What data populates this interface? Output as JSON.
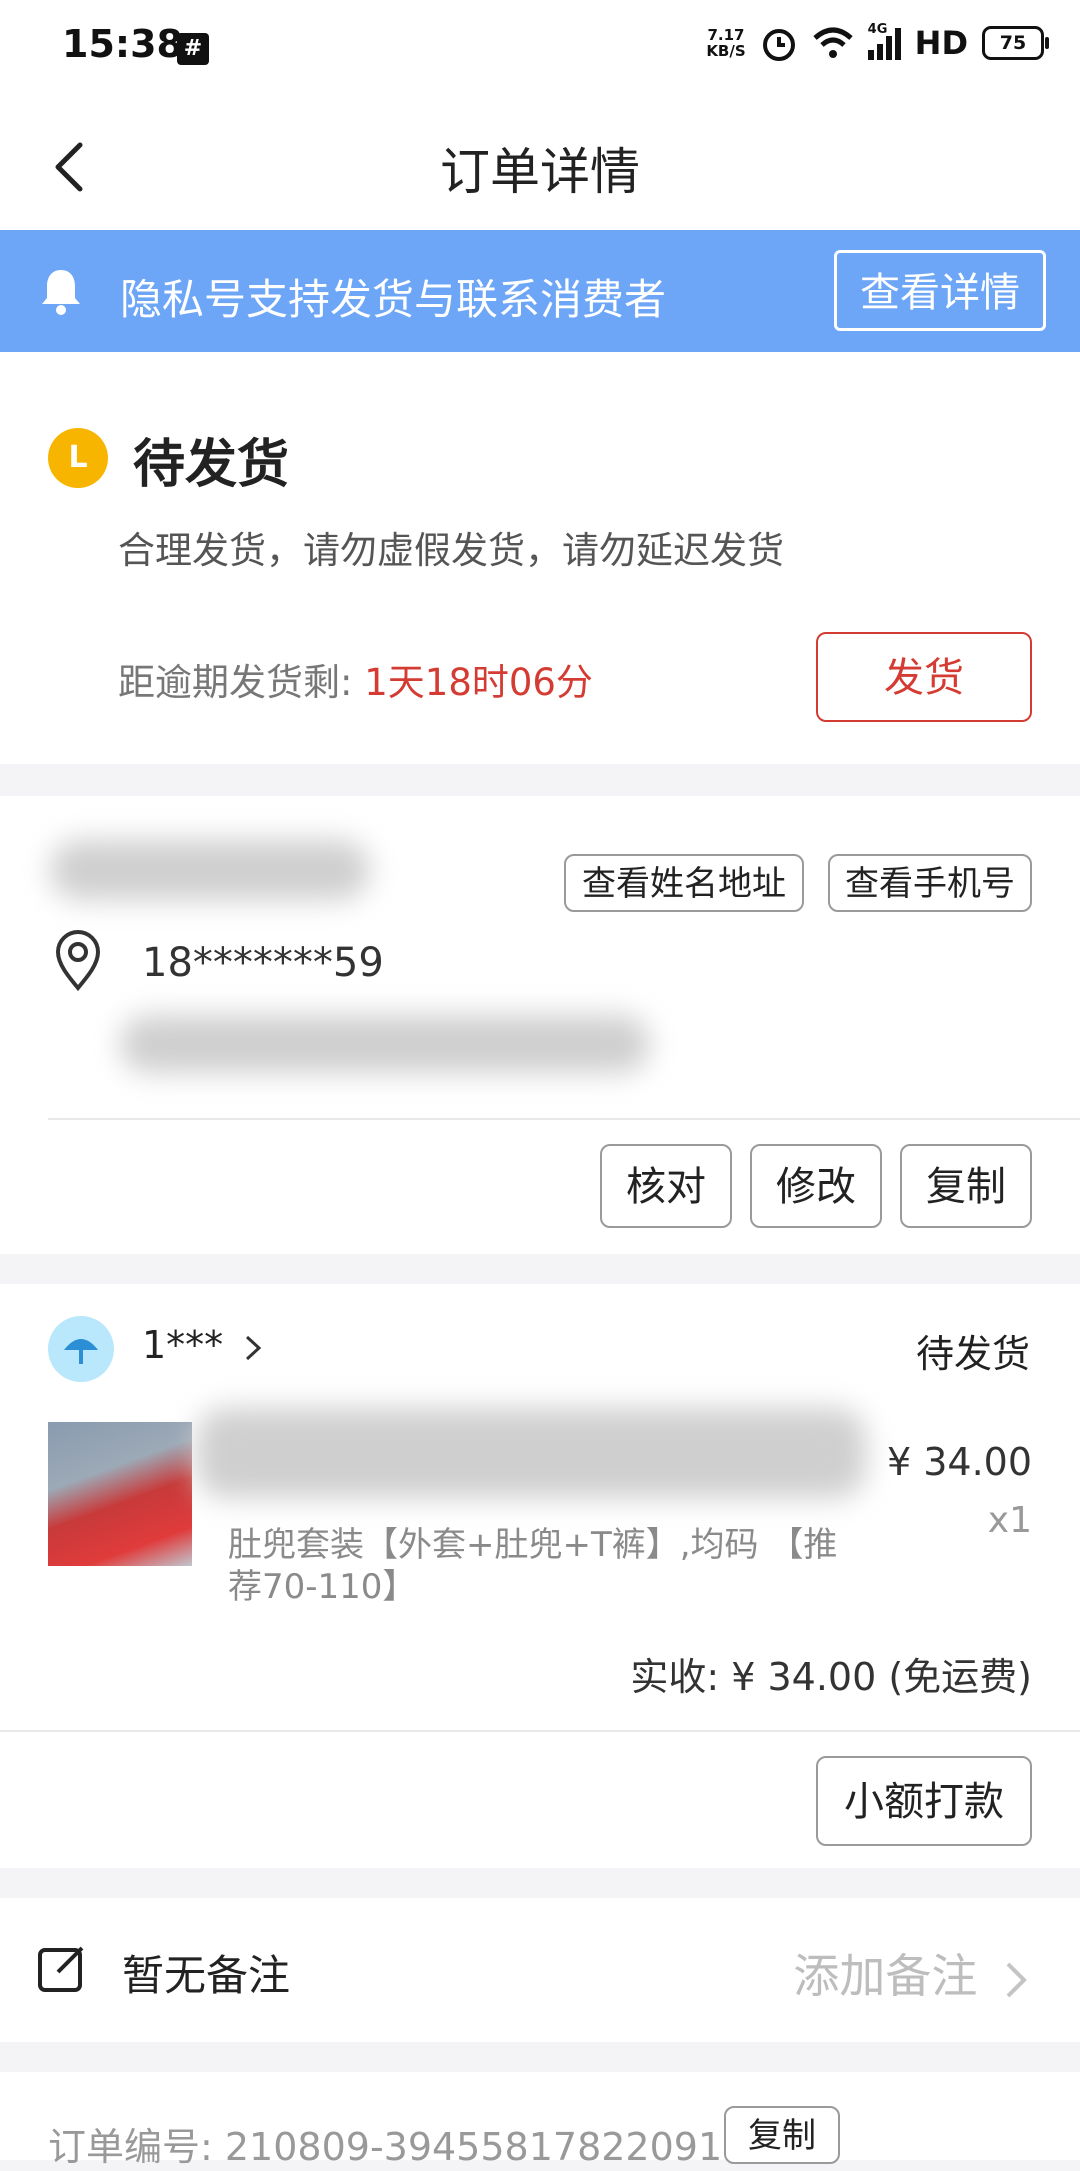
{
  "status_bar": {
    "time": "15:38",
    "notification_glyph": "#",
    "net_speed_value": "7.17",
    "net_speed_unit": "KB/S",
    "network_label": "4G",
    "hd_label": "HD",
    "battery": "75"
  },
  "nav": {
    "title": "订单详情"
  },
  "banner": {
    "text": "隐私号支持发货与联系消费者",
    "button": "查看详情"
  },
  "order_status": {
    "icon_letter": "L",
    "title": "待发货",
    "description": "合理发货，请勿虚假发货，请勿延迟发货",
    "deadline_label": "距逾期发货剩: ",
    "deadline_value": "1天18时06分",
    "ship_button": "发货"
  },
  "address": {
    "view_name_button": "查看姓名地址",
    "view_phone_button": "查看手机号",
    "phone": "18*******59",
    "actions": [
      "核对",
      "修改",
      "复制"
    ]
  },
  "product": {
    "seller_name": "1***",
    "state": "待发货",
    "sku": "肚兜套装【外套+肚兜+T裤】,均码 【推荐70-110】",
    "price": "¥ 34.00",
    "quantity": "x1",
    "received": "实收: ¥ 34.00 (免运费)",
    "small_payment_button": "小额打款"
  },
  "remark": {
    "label": "暂无备注",
    "add": "添加备注"
  },
  "order_info": {
    "order_number": "订单编号: 210809-394558178220914",
    "copy": "复制"
  },
  "colors": {
    "banner": "#6ea6f7",
    "accent_red": "#d43c33",
    "status_yellow": "#f7b500"
  }
}
